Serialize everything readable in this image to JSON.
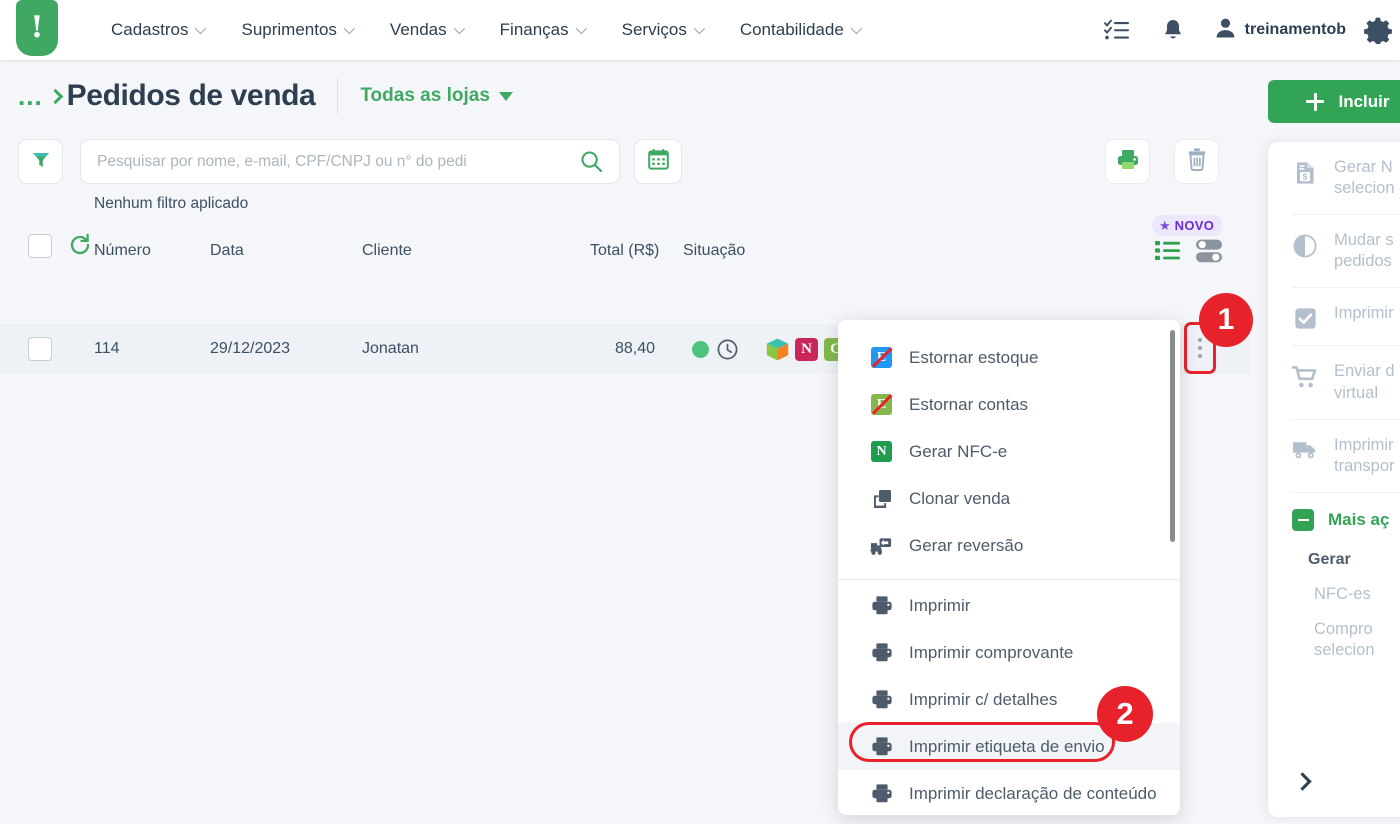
{
  "colors": {
    "brand_green": "#32a456",
    "title_navy": "#2c3e50",
    "marker_red": "#e8222a",
    "novo_purple": "#6c2bd9",
    "muted_text": "#b4bfcd"
  },
  "topnav": {
    "logo_icon": "tiny-exclamation-logo",
    "logo_glyph": "!",
    "items": [
      {
        "label": "Cadastros",
        "has_caret": true
      },
      {
        "label": "Suprimentos",
        "has_caret": true
      },
      {
        "label": "Vendas",
        "has_caret": true
      },
      {
        "label": "Finanças",
        "has_caret": true
      },
      {
        "label": "Serviços",
        "has_caret": true
      },
      {
        "label": "Contabilidade",
        "has_caret": true
      }
    ],
    "tasks_icon": "checklist-icon",
    "bell_icon": "bell-icon",
    "user_icon": "person-icon",
    "user_name": "treinamentob",
    "gear_icon": "gear-icon"
  },
  "page": {
    "breadcrumb_dots": "...",
    "title": "Pedidos de venda",
    "store_selector": "Todas as lojas",
    "add_button": "Incluir",
    "add_icon": "plus-icon"
  },
  "toolbar": {
    "filter_icon": "funnel-icon",
    "search_placeholder": "Pesquisar por nome, e-mail, CPF/CNPJ ou n° do pedi",
    "search_value": "",
    "search_icon": "magnifier-icon",
    "calendar_icon": "calendar-icon",
    "print_icon": "printer-icon",
    "trash_icon": "trash-icon",
    "no_filter_text": "Nenhum filtro aplicado",
    "novo_badge": "NOVO",
    "novo_star_icon": "star-icon",
    "list_view_icon": "list-view-icon",
    "toggle_view_icon": "toggle-switches-icon",
    "refresh_icon": "refresh-icon"
  },
  "table": {
    "columns": [
      "Número",
      "Data",
      "Cliente",
      "Total (R$)",
      "Situação"
    ],
    "rows": [
      {
        "numero": "114",
        "data": "29/12/2023",
        "cliente": "Jonatan",
        "total": "88,40",
        "situacao_icons": [
          "green-dot-icon",
          "clock-icon",
          "cube-icon",
          "nfe-badge-icon",
          "nfce-badge-icon"
        ],
        "badge_n": "N",
        "badge_c": "C",
        "row_menu_icon": "vertical-dots-icon"
      }
    ]
  },
  "dropdown": {
    "group_one": [
      {
        "label": "Estornar estoque",
        "icon": "reverse-stock-icon",
        "icon_color": "#2196f3"
      },
      {
        "label": "Estornar contas",
        "icon": "reverse-accounts-icon",
        "icon_color": "#84b84c"
      },
      {
        "label": "Gerar NFC-e",
        "icon": "nfce-icon",
        "icon_color": "#1f9d4e",
        "icon_letter": "N"
      },
      {
        "label": "Clonar venda",
        "icon": "clone-icon",
        "icon_color": "#4d5b6b"
      },
      {
        "label": "Gerar reversão",
        "icon": "reversal-truck-icon",
        "icon_color": "#4d5b6b"
      }
    ],
    "group_two": [
      {
        "label": "Imprimir",
        "icon": "printer-icon",
        "selected": false
      },
      {
        "label": "Imprimir comprovante",
        "icon": "printer-icon",
        "selected": false
      },
      {
        "label": "Imprimir c/ detalhes",
        "icon": "printer-icon",
        "selected": false
      },
      {
        "label": "Imprimir etiqueta de envio",
        "icon": "printer-icon",
        "selected": true
      },
      {
        "label": "Imprimir declaração de conteúdo",
        "icon": "printer-icon",
        "selected": false
      }
    ]
  },
  "markers": {
    "one": "1",
    "two": "2"
  },
  "right_panel": {
    "items": [
      {
        "label_line1": "Gerar N",
        "label_line2": "selecion",
        "icon": "invoice-money-icon"
      },
      {
        "label_line1": "Mudar s",
        "label_line2": "pedidos",
        "icon": "contrast-circle-icon"
      },
      {
        "label_line1": "Imprimir",
        "label_line2": "",
        "icon": "checkbox-checked-icon"
      },
      {
        "label_line1": "Enviar d",
        "label_line2": "virtual",
        "icon": "cart-icon"
      },
      {
        "label_line1": "Imprimir",
        "label_line2": "transpor",
        "icon": "truck-icon"
      }
    ],
    "more_actions": {
      "label": "Mais aç",
      "icon": "minus-square-icon"
    },
    "section_title": "Gerar",
    "sub_items": [
      {
        "label_line1": "NFC-es",
        "label_line2": ""
      },
      {
        "label_line1": "Compro",
        "label_line2": "selecion"
      }
    ],
    "collapse_icon": "chevron-right-icon"
  }
}
